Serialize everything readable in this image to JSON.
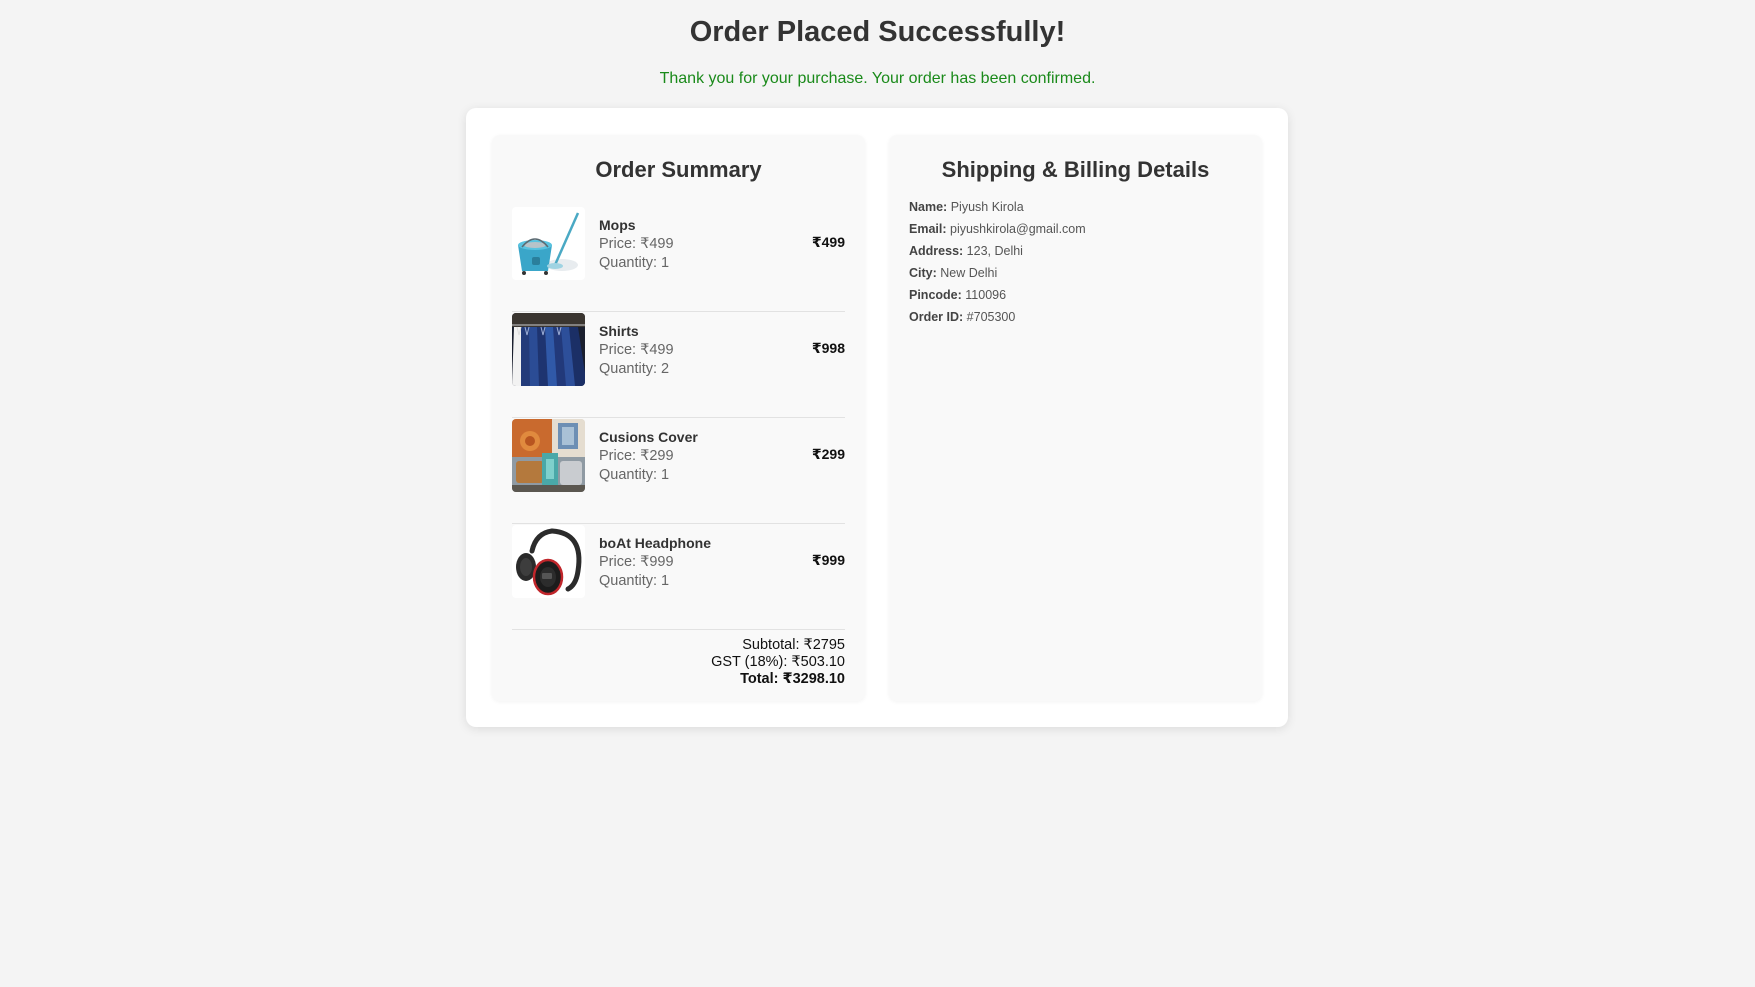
{
  "header": {
    "title": "Order Placed Successfully!",
    "subtitle": "Thank you for your purchase. Your order has been confirmed."
  },
  "order_summary": {
    "title": "Order Summary",
    "items": [
      {
        "name": "Mops",
        "price": "Price: ₹499",
        "quantity": "Quantity: 1",
        "total": "₹499",
        "image": "mop-bucket-image"
      },
      {
        "name": "Shirts",
        "price": "Price: ₹499",
        "quantity": "Quantity: 2",
        "total": "₹998",
        "image": "shirts-rack-image"
      },
      {
        "name": "Cusions Cover",
        "price": "Price: ₹299",
        "quantity": "Quantity: 1",
        "total": "₹299",
        "image": "cushion-covers-image"
      },
      {
        "name": "boAt Headphone",
        "price": "Price: ₹999",
        "quantity": "Quantity: 1",
        "total": "₹999",
        "image": "headphone-image"
      }
    ],
    "subtotal": "Subtotal: ₹2795",
    "gst": "GST (18%): ₹503.10",
    "total": "Total: ₹3298.10"
  },
  "shipping": {
    "title": "Shipping & Billing Details",
    "rows": [
      {
        "key": "Name:",
        "value": "Piyush Kirola"
      },
      {
        "key": "Email:",
        "value": "piyushkirola@gmail.com"
      },
      {
        "key": "Address:",
        "value": "123, Delhi"
      },
      {
        "key": "City:",
        "value": "New Delhi"
      },
      {
        "key": "Pincode:",
        "value": "110096"
      },
      {
        "key": "Order ID:",
        "value": "#705300"
      }
    ]
  },
  "colors": {
    "background": "#f4f4f4",
    "success_text": "#1a8a1a",
    "card": "#ffffff",
    "panel": "#f9f9f9"
  }
}
